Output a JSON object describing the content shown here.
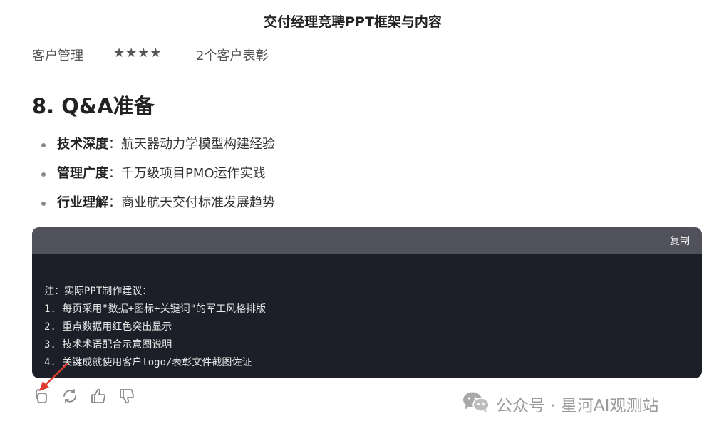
{
  "document": {
    "title": "交付经理竞聘PPT框架与内容"
  },
  "table_row": {
    "col1": "客户管理",
    "col2": "★★★★",
    "col3": "2个客户表彰"
  },
  "section": {
    "heading": "8. Q&A准备",
    "items": [
      {
        "term": "技术深度",
        "sep": "：",
        "desc": "航天器动力学模型构建经验"
      },
      {
        "term": "管理广度",
        "sep": "：",
        "desc": "千万级项目PMO运作实践"
      },
      {
        "term": "行业理解",
        "sep": "：",
        "desc": "商业航天交付标准发展趋势"
      }
    ]
  },
  "code_block": {
    "copy_label": "复制",
    "lines": [
      "注：实际PPT制作建议：",
      "1. 每页采用\"数据+图标+关键词\"的军工风格排版",
      "2. 重点数据用红色突出显示",
      "3. 技术术语配合示意图说明",
      "4. 关键成就使用客户logo/表彰文件截图佐证"
    ]
  },
  "actions": {
    "icons": [
      "copy-icon",
      "regenerate-icon",
      "thumbs-up-icon",
      "thumbs-down-icon"
    ]
  },
  "watermark": {
    "text": "公众号 · 星河AI观测站"
  },
  "colors": {
    "code_bg": "#1d1f28",
    "code_header_bg": "#50515a",
    "arrow": "#e03c31"
  }
}
